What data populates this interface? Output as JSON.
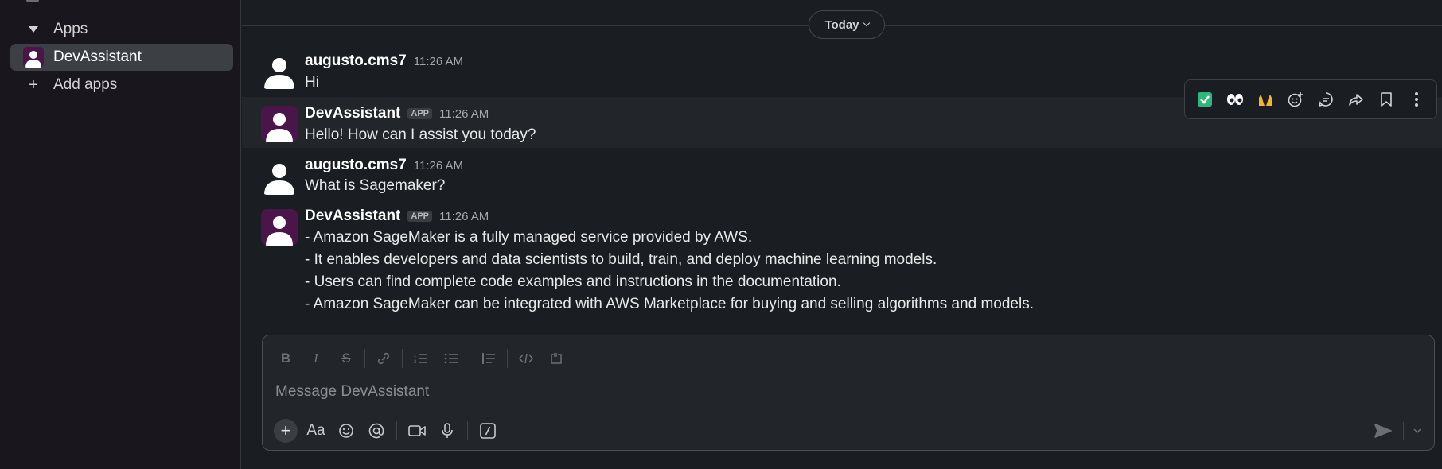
{
  "sidebar": {
    "section_label": "Apps",
    "items": [
      {
        "label": "DevAssistant",
        "active": true
      },
      {
        "label": "Add apps"
      }
    ]
  },
  "channel": {
    "date_divider": "Today"
  },
  "messages": [
    {
      "author": "augusto.cms7",
      "time": "11:26 AM",
      "lines": [
        "Hi"
      ]
    },
    {
      "author": "DevAssistant",
      "badge": "APP",
      "time": "11:26 AM",
      "lines": [
        "Hello! How can I assist you today?"
      ]
    },
    {
      "author": "augusto.cms7",
      "time": "11:26 AM",
      "lines": [
        "What is Sagemaker?"
      ]
    },
    {
      "author": "DevAssistant",
      "badge": "APP",
      "time": "11:26 AM",
      "lines": [
        "- Amazon SageMaker is a fully managed service provided by AWS.",
        "- It enables developers and data scientists to build, train, and deploy machine learning models.",
        "- Users can find complete code examples and instructions in the documentation.",
        "- Amazon SageMaker can be integrated with AWS Marketplace for buying and selling algorithms and models."
      ]
    }
  ],
  "hover_actions": [
    "check-reaction",
    "eyes-reaction",
    "raised-hands-reaction",
    "add-reaction",
    "reply-in-thread",
    "forward",
    "save",
    "more-actions"
  ],
  "composer": {
    "placeholder": "Message DevAssistant"
  },
  "colors": {
    "background": "#1a1d21",
    "sidebar": "#19171d",
    "bot_avatar": "#4a154b",
    "active_item": "#3c3f44"
  }
}
